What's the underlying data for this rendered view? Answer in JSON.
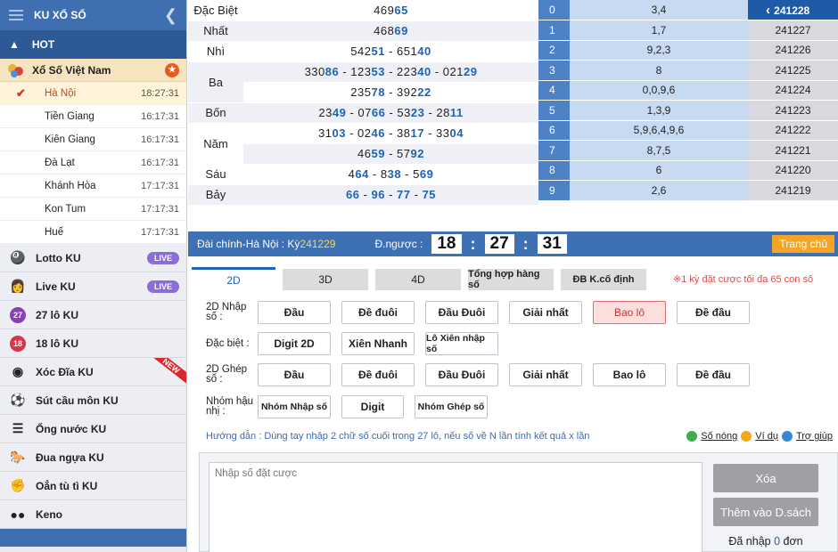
{
  "sidebar": {
    "title": "KU XỔ SỐ",
    "hot": "HOT",
    "xoso": "Xổ Số Việt Nam",
    "cities": [
      {
        "name": "Hà Nội",
        "time": "18:27:31"
      },
      {
        "name": "Tiền Giang",
        "time": "16:17:31"
      },
      {
        "name": "Kiên Giang",
        "time": "16:17:31"
      },
      {
        "name": "Đà Lạt",
        "time": "16:17:31"
      },
      {
        "name": "Khánh Hòa",
        "time": "17:17:31"
      },
      {
        "name": "Kon Tum",
        "time": "17:17:31"
      },
      {
        "name": "Huế",
        "time": "17:17:31"
      }
    ],
    "menu": [
      {
        "label": "Lotto KU",
        "badge": "LIVE"
      },
      {
        "label": "Live KU",
        "badge": "LIVE"
      },
      {
        "label": "27 lô KU"
      },
      {
        "label": "18 lô KU"
      },
      {
        "label": "Xóc Đĩa KU",
        "ribbon": "NEW"
      },
      {
        "label": "Sút cầu môn KU"
      },
      {
        "label": "Ống nước KU"
      },
      {
        "label": "Đua ngựa KU"
      },
      {
        "label": "Oẳn tù tì KU"
      },
      {
        "label": "Keno"
      }
    ]
  },
  "results": {
    "rows": [
      {
        "label": "Đặc Biệt",
        "a": "469",
        "b": "65"
      },
      {
        "label": "Nhất",
        "a": "468",
        "b": "69"
      },
      {
        "label": "Nhì",
        "value": "54251 - 65140"
      },
      {
        "label": "Ba",
        "value": "33086 - 12353 - 22340 - 02129",
        "value2": "23578 - 39222"
      },
      {
        "label": "Bốn",
        "value": "2349 - 0766 - 5323 - 2811"
      },
      {
        "label": "Năm",
        "value": "3103 - 0246 - 3817 - 3304",
        "value2": "4659 - 5792"
      },
      {
        "label": "Sáu",
        "value": "464 - 838 - 569"
      },
      {
        "label": "Bảy",
        "value": "66 - 96 - 77 - 75"
      }
    ]
  },
  "heads": [
    {
      "k": "0",
      "v": "3,4",
      "d": "241228"
    },
    {
      "k": "1",
      "v": "1,7",
      "d": "241227"
    },
    {
      "k": "2",
      "v": "9,2,3",
      "d": "241226"
    },
    {
      "k": "3",
      "v": "8",
      "d": "241225"
    },
    {
      "k": "4",
      "v": "0,0,9,6",
      "d": "241224"
    },
    {
      "k": "5",
      "v": "1,3,9",
      "d": "241223"
    },
    {
      "k": "6",
      "v": "5,9,6,4,9,6",
      "d": "241222"
    },
    {
      "k": "7",
      "v": "8,7,5",
      "d": "241221"
    },
    {
      "k": "8",
      "v": "6",
      "d": "241220"
    },
    {
      "k": "9",
      "v": "2,6",
      "d": "241219"
    }
  ],
  "bar": {
    "label": "Đài chính-Hà Nội  : Kỳ ",
    "ky": "241229",
    "countdown_label": "Đ.ngược :",
    "h": "18",
    "m": "27",
    "s": "31",
    "home": "Trang chủ"
  },
  "tabs": [
    "2D",
    "3D",
    "4D",
    "Tổng hợp hàng số",
    "ĐB K.cố định"
  ],
  "note": "※1 kỳ đặt cược tối đa 65 con số",
  "rows": [
    {
      "label": "2D Nhập số :",
      "buttons": [
        "Đầu",
        "Đề đuôi",
        "Đầu Đuôi",
        "Giải nhất",
        "Bao lô",
        "Đề đầu"
      ]
    },
    {
      "label": "Đặc biệt :",
      "buttons": [
        "Digit 2D",
        "Xiên Nhanh",
        "Lô Xiên nhập số"
      ]
    },
    {
      "label": "2D Ghép số :",
      "buttons": [
        "Đầu",
        "Đề đuôi",
        "Đầu Đuôi",
        "Giải nhất",
        "Bao lô",
        "Đề đầu"
      ]
    },
    {
      "label": "Nhóm hậu nhị :",
      "buttons": [
        "Nhóm Nhập số",
        "Digit",
        "Nhóm Ghép số"
      ]
    }
  ],
  "guide": {
    "text": "Hướng dẫn : Dùng tay nhập 2 chữ số cuối trong 27 lô, nếu số về N lần tính kết quả x lần",
    "hot": "Số nóng",
    "example": "Ví dụ",
    "help": "Trợ giúp"
  },
  "input": {
    "placeholder": "Nhập số đặt cược",
    "delete": "Xóa",
    "add": "Thêm vào D.sách",
    "count_pre": "Đã nhập ",
    "count": "0",
    "count_post": " đơn"
  }
}
